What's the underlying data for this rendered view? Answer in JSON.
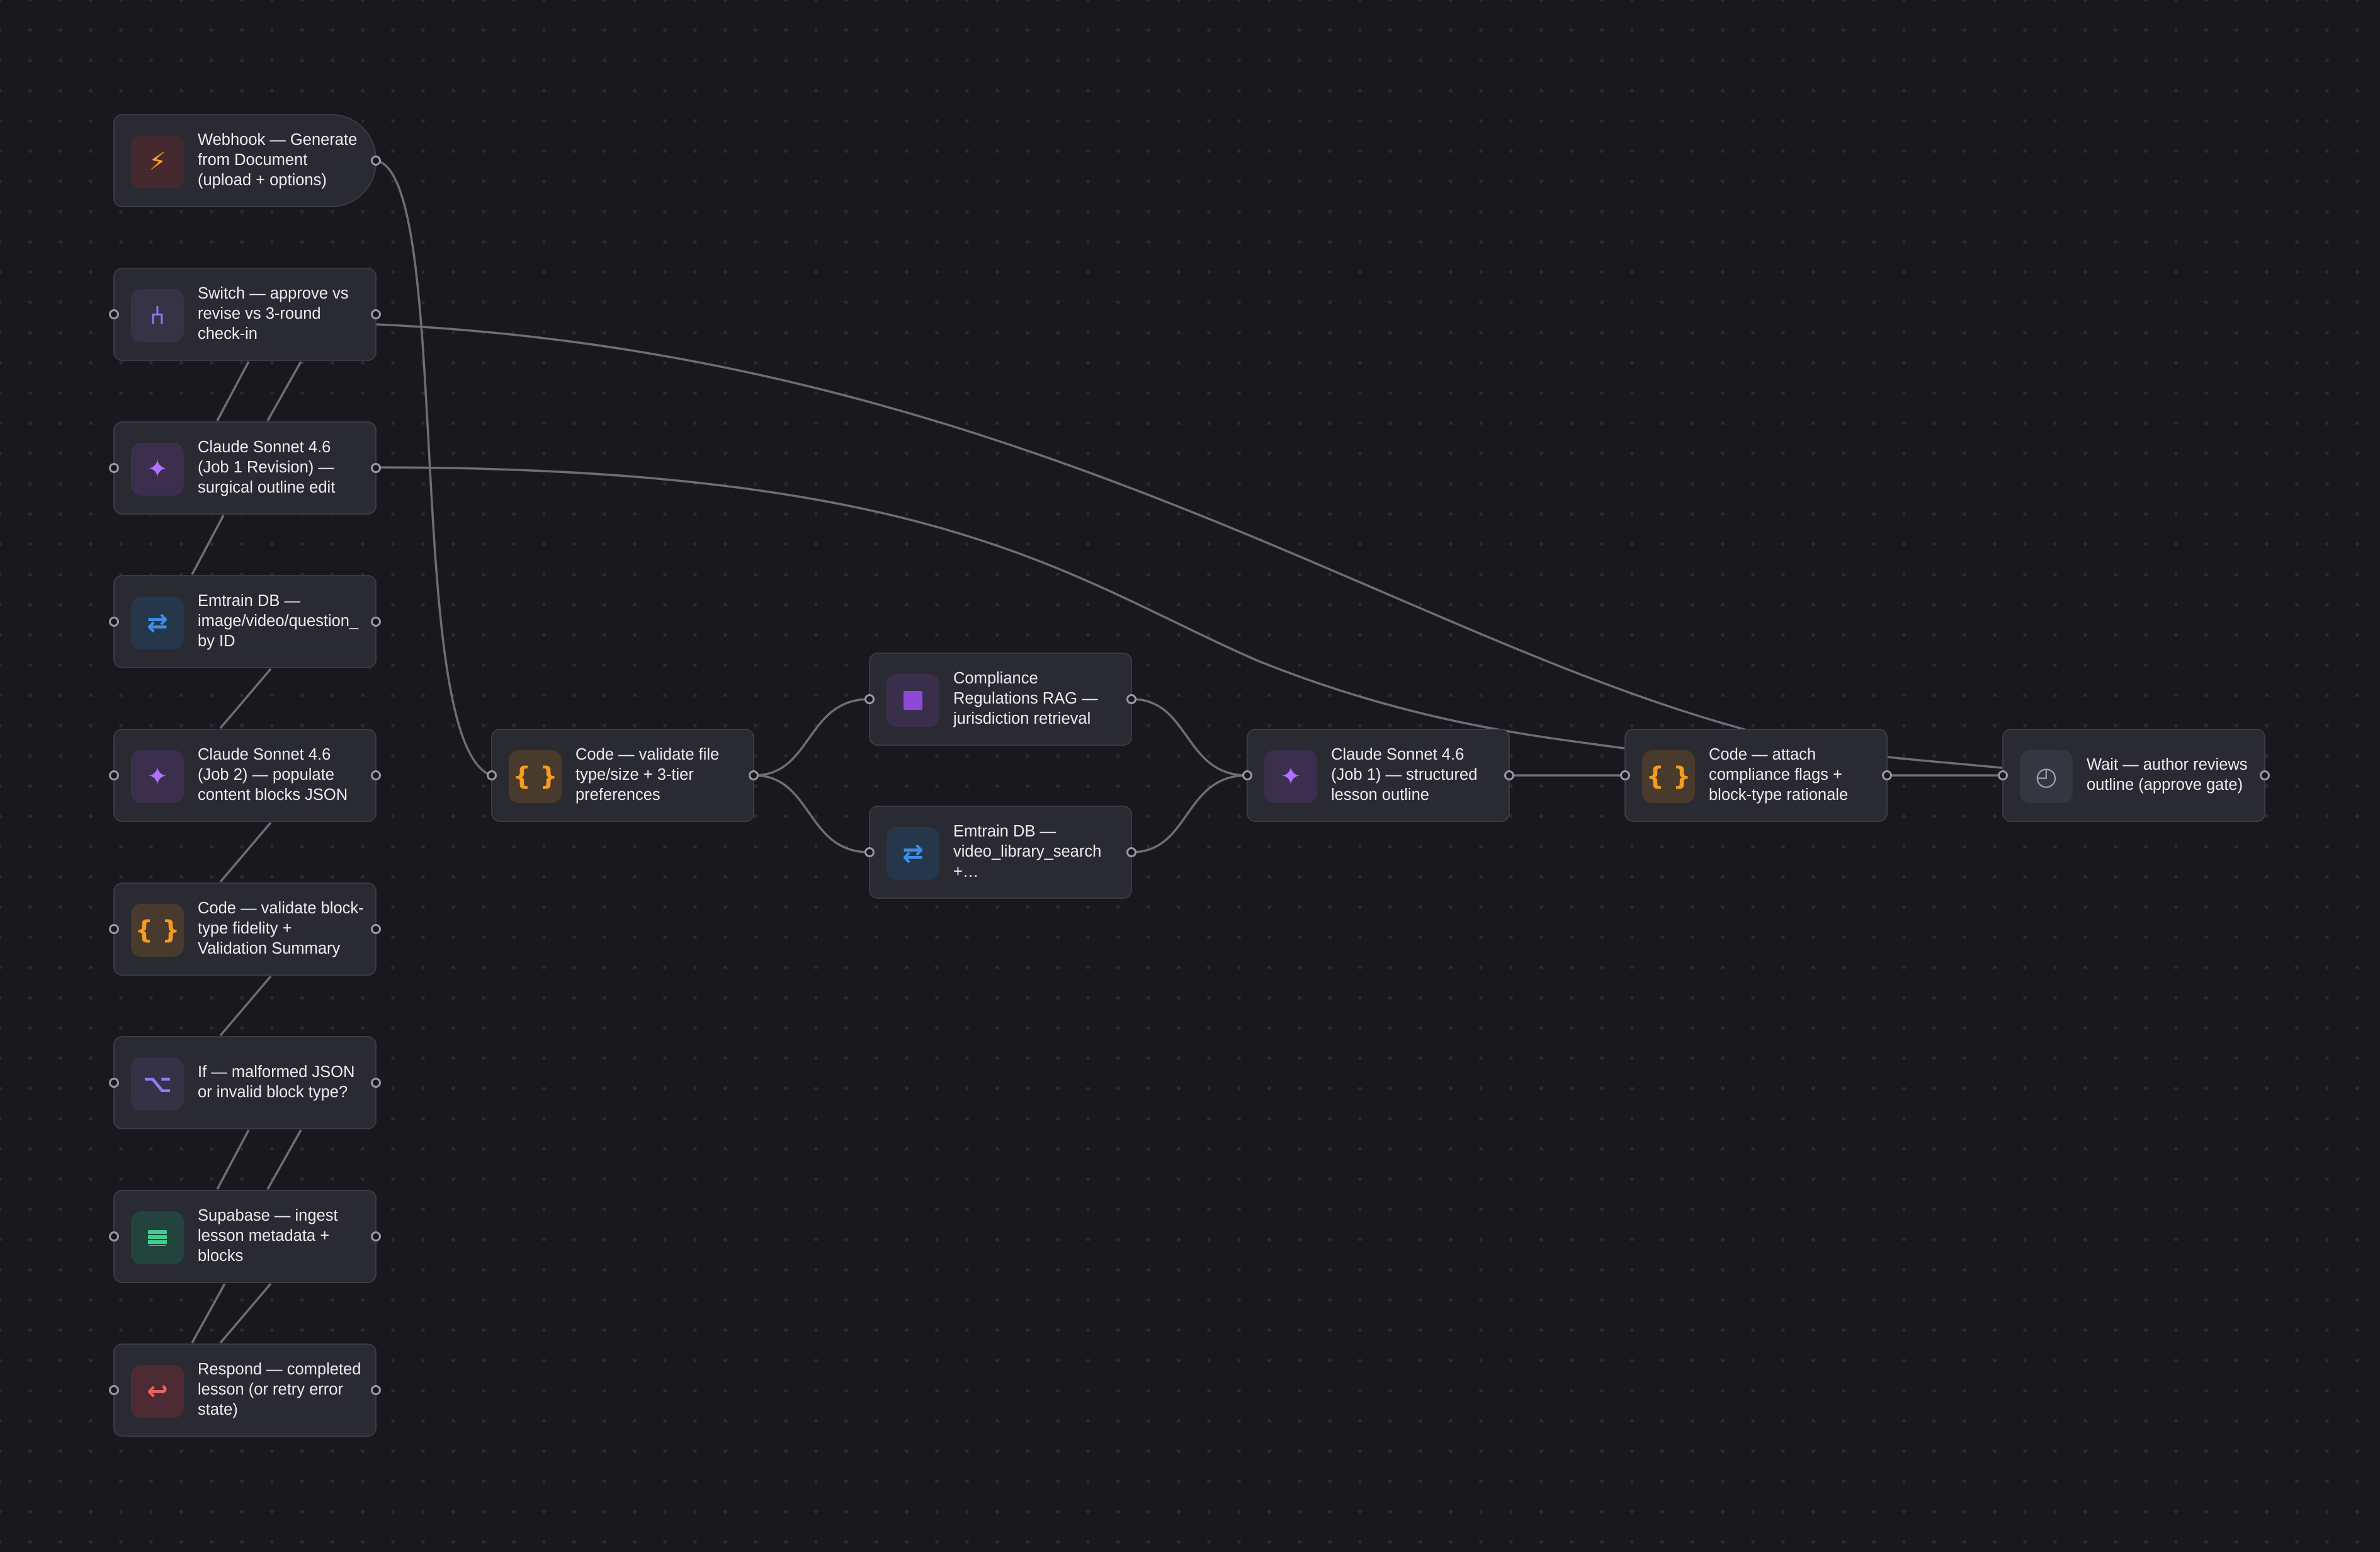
{
  "nodes": {
    "webhook": {
      "label": "Webhook — Generate from Document (upload + options)",
      "icon": "lightning-icon"
    },
    "switch": {
      "label": "Switch — approve vs revise vs 3-round check-in",
      "icon": "switch-icon"
    },
    "claude_rev": {
      "label": "Claude Sonnet 4.6 (Job 1 Revision) — surgical outline edit",
      "icon": "sparkle-icon"
    },
    "emtrain_id": {
      "label": "Emtrain DB — image/video/question_by ID",
      "icon": "arrows-icon"
    },
    "claude_job2": {
      "label": "Claude Sonnet 4.6 (Job 2) — populate content blocks JSON",
      "icon": "sparkle-icon"
    },
    "code_fidelity": {
      "label": "Code — validate block-type fidelity + Validation Summary",
      "icon": "braces-icon"
    },
    "if_malformed": {
      "label": "If — malformed JSON or invalid block type?",
      "icon": "branch-icon"
    },
    "supabase": {
      "label": "Supabase — ingest lesson metadata + blocks",
      "icon": "database-icon"
    },
    "respond": {
      "label": "Respond — completed lesson (or retry error state)",
      "icon": "return-icon"
    },
    "code_validate": {
      "label": "Code — validate file type/size + 3-tier preferences",
      "icon": "braces-icon"
    },
    "rag": {
      "label": "Compliance Regulations RAG — jurisdiction retrieval",
      "icon": "rag-icon"
    },
    "emtrain_video": {
      "label": "Emtrain DB — video_library_search +…",
      "icon": "arrows-icon"
    },
    "claude_job1": {
      "label": "Claude Sonnet 4.6 (Job 1) — structured lesson outline",
      "icon": "sparkle-icon"
    },
    "code_attach": {
      "label": "Code — attach compliance flags + block-type rationale",
      "icon": "braces-icon"
    },
    "wait": {
      "label": "Wait — author reviews outline (approve gate)",
      "icon": "clock-icon"
    }
  }
}
